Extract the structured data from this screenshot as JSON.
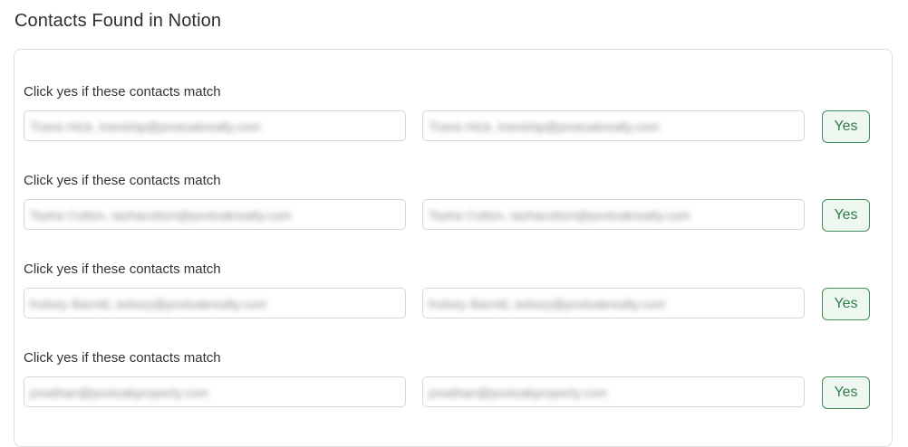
{
  "title": "Contacts Found in Notion",
  "matches": [
    {
      "prompt": "Click yes if these contacts match",
      "left_contact": "Travis Hick, traviship@pxxtoakrealty.com",
      "right_contact": "Travis Hick, traviship@pxxtoakrealty.com",
      "yes_label": "Yes"
    },
    {
      "prompt": "Click yes if these contacts match",
      "left_contact": "Tasha Cotton, tashacotton@pxxtoakrealty.com",
      "right_contact": "Tasha Cotton, tashacotton@pxxtoakrealty.com",
      "yes_label": "Yes"
    },
    {
      "prompt": "Click yes if these contacts match",
      "left_contact": "Kelsey Barrett, kelsey@pxxtoakrealty.com",
      "right_contact": "Kelsey Barrett, kelsey@pxxtoakrealty.com",
      "yes_label": "Yes"
    },
    {
      "prompt": "Click yes if these contacts match",
      "left_contact": "jonathan@pxxtoakproperty.com",
      "right_contact": "jonathan@pxxtoakproperty.com",
      "yes_label": "Yes"
    }
  ],
  "colors": {
    "accent_green": "#2f7a48",
    "button_background": "#eef8f1",
    "border": "#dedede"
  }
}
